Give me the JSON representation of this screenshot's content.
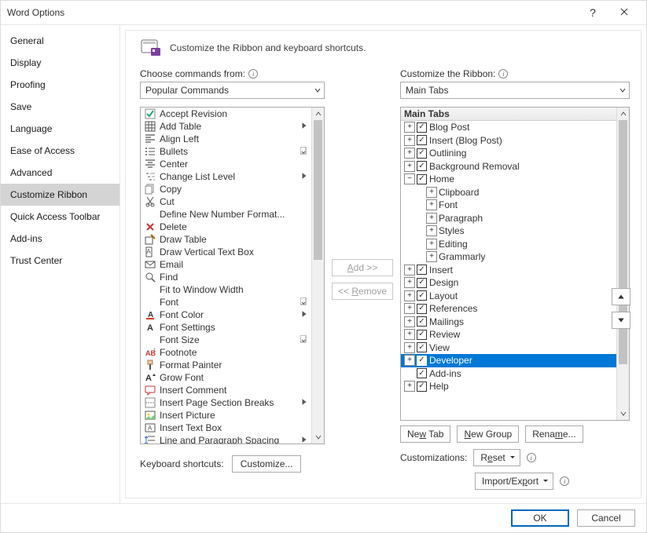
{
  "window": {
    "title": "Word Options"
  },
  "sidebar": {
    "items": [
      {
        "label": "General"
      },
      {
        "label": "Display"
      },
      {
        "label": "Proofing"
      },
      {
        "label": "Save"
      },
      {
        "label": "Language"
      },
      {
        "label": "Ease of Access"
      },
      {
        "label": "Advanced"
      },
      {
        "label": "Customize Ribbon",
        "selected": true
      },
      {
        "label": "Quick Access Toolbar"
      },
      {
        "label": "Add-ins"
      },
      {
        "label": "Trust Center"
      }
    ]
  },
  "header": {
    "text": "Customize the Ribbon and keyboard shortcuts."
  },
  "left": {
    "label": "Choose commands from:",
    "combo": "Popular Commands",
    "commands": [
      {
        "label": "Accept Revision",
        "ic": "accept"
      },
      {
        "label": "Add Table",
        "ic": "table",
        "sub": "tri"
      },
      {
        "label": "Align Left",
        "ic": "alignl"
      },
      {
        "label": "Bullets",
        "ic": "bullets",
        "sub": "dd"
      },
      {
        "label": "Center",
        "ic": "center"
      },
      {
        "label": "Change List Level",
        "ic": "listlevel",
        "sub": "tri"
      },
      {
        "label": "Copy",
        "ic": "copy"
      },
      {
        "label": "Cut",
        "ic": "cut"
      },
      {
        "label": "Define New Number Format...",
        "ic": "blank"
      },
      {
        "label": "Delete",
        "ic": "delete"
      },
      {
        "label": "Draw Table",
        "ic": "drawtable"
      },
      {
        "label": "Draw Vertical Text Box",
        "ic": "vtextbox"
      },
      {
        "label": "Email",
        "ic": "email"
      },
      {
        "label": "Find",
        "ic": "find"
      },
      {
        "label": "Fit to Window Width",
        "ic": "blank"
      },
      {
        "label": "Font",
        "ic": "blank",
        "sub": "dd"
      },
      {
        "label": "Font Color",
        "ic": "fontcolor",
        "sub": "tri"
      },
      {
        "label": "Font Settings",
        "ic": "fontA"
      },
      {
        "label": "Font Size",
        "ic": "blank",
        "sub": "dd"
      },
      {
        "label": "Footnote",
        "ic": "footnote"
      },
      {
        "label": "Format Painter",
        "ic": "painter"
      },
      {
        "label": "Grow Font",
        "ic": "growfont"
      },
      {
        "label": "Insert Comment",
        "ic": "comment"
      },
      {
        "label": "Insert Page  Section Breaks",
        "ic": "breaks",
        "sub": "tri"
      },
      {
        "label": "Insert Picture",
        "ic": "picture"
      },
      {
        "label": "Insert Text Box",
        "ic": "textbox"
      },
      {
        "label": "Line and Paragraph Spacing",
        "ic": "spacing",
        "sub": "tri"
      }
    ],
    "kb_label": "Keyboard shortcuts:",
    "kb_button": "Customize..."
  },
  "mid": {
    "add": "Add >>",
    "remove": "<< Remove"
  },
  "right": {
    "label": "Customize the Ribbon:",
    "combo": "Main Tabs",
    "tree_header": "Main Tabs",
    "nodes": [
      {
        "depth": 0,
        "tw": "+",
        "cb": true,
        "label": "Blog Post"
      },
      {
        "depth": 0,
        "tw": "+",
        "cb": true,
        "label": "Insert (Blog Post)"
      },
      {
        "depth": 0,
        "tw": "+",
        "cb": true,
        "label": "Outlining"
      },
      {
        "depth": 0,
        "tw": "+",
        "cb": true,
        "label": "Background Removal"
      },
      {
        "depth": 0,
        "tw": "-",
        "cb": true,
        "label": "Home"
      },
      {
        "depth": 1,
        "tw": "+",
        "label": "Clipboard"
      },
      {
        "depth": 1,
        "tw": "+",
        "label": "Font"
      },
      {
        "depth": 1,
        "tw": "+",
        "label": "Paragraph"
      },
      {
        "depth": 1,
        "tw": "+",
        "label": "Styles"
      },
      {
        "depth": 1,
        "tw": "+",
        "label": "Editing"
      },
      {
        "depth": 1,
        "tw": "+",
        "label": "Grammarly"
      },
      {
        "depth": 0,
        "tw": "+",
        "cb": true,
        "label": "Insert"
      },
      {
        "depth": 0,
        "tw": "+",
        "cb": true,
        "label": "Design"
      },
      {
        "depth": 0,
        "tw": "+",
        "cb": true,
        "label": "Layout"
      },
      {
        "depth": 0,
        "tw": "+",
        "cb": true,
        "label": "References"
      },
      {
        "depth": 0,
        "tw": "+",
        "cb": true,
        "label": "Mailings"
      },
      {
        "depth": 0,
        "tw": "+",
        "cb": true,
        "label": "Review"
      },
      {
        "depth": 0,
        "tw": "+",
        "cb": true,
        "label": "View"
      },
      {
        "depth": 0,
        "tw": "+",
        "cb": true,
        "label": "Developer",
        "selected": true
      },
      {
        "depth": 0,
        "tw": " ",
        "cb": true,
        "label": "Add-ins"
      },
      {
        "depth": 0,
        "tw": "+",
        "cb": true,
        "label": "Help"
      }
    ],
    "new_tab": "New Tab",
    "new_group": "New Group",
    "rename": "Rename...",
    "cust_label": "Customizations:",
    "reset": "Reset",
    "import": "Import/Export"
  },
  "footer": {
    "ok": "OK",
    "cancel": "Cancel"
  }
}
